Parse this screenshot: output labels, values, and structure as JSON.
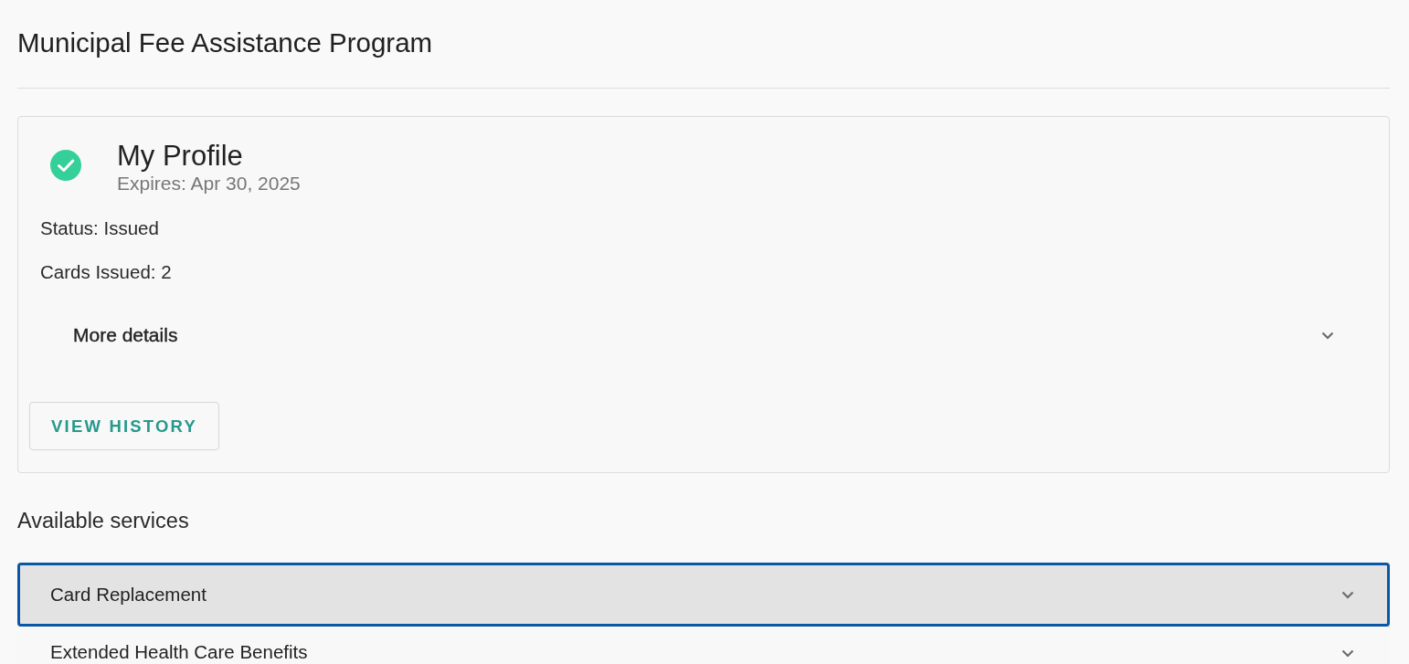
{
  "page": {
    "title": "Municipal Fee Assistance Program"
  },
  "profile": {
    "title": "My Profile",
    "verified": true,
    "subtitle": "Expires: Apr 30, 2025",
    "fields": [
      "Status: Issued",
      "Cards Issued: 2"
    ],
    "details": {
      "label": "More details",
      "expanded": false
    },
    "button": "VIEW HISTORY"
  },
  "services": {
    "heading": "Available services",
    "items": [
      {
        "label": "Card Replacement",
        "expanded": false,
        "focused": true
      },
      {
        "label": "Extended Health Care Benefits",
        "expanded": false,
        "focused": false
      }
    ]
  }
}
